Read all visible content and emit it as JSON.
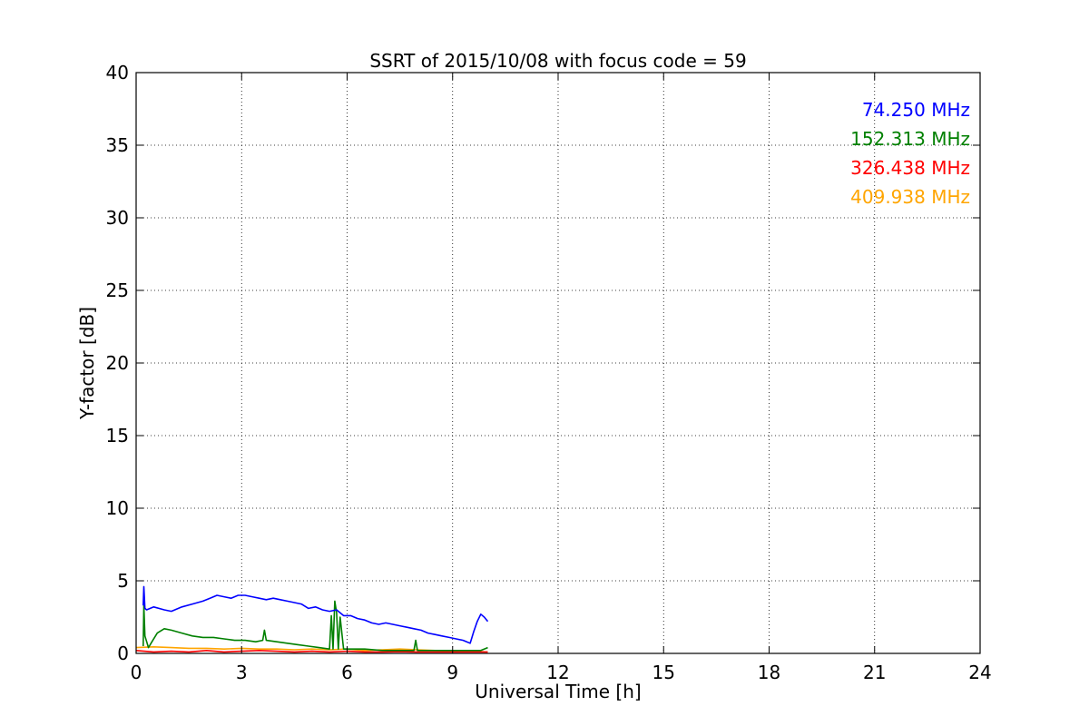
{
  "chart_data": {
    "type": "line",
    "title": "SSRT of 2015/10/08 with focus code = 59",
    "xlabel": "Universal Time [h]",
    "ylabel": "Y-factor [dB]",
    "xlim": [
      0,
      24
    ],
    "ylim": [
      0,
      40
    ],
    "xticks": [
      0,
      3,
      6,
      9,
      12,
      15,
      18,
      21,
      24
    ],
    "yticks": [
      0,
      5,
      10,
      15,
      20,
      25,
      30,
      35,
      40
    ],
    "grid": true,
    "legend_position": "top-right",
    "series": [
      {
        "name": "74.250 MHz",
        "color": "#0000ff",
        "x": [
          0.2,
          0.22,
          0.25,
          0.3,
          0.5,
          0.8,
          1.0,
          1.3,
          1.6,
          1.9,
          2.1,
          2.3,
          2.5,
          2.7,
          2.9,
          3.1,
          3.3,
          3.5,
          3.7,
          3.9,
          4.1,
          4.3,
          4.5,
          4.7,
          4.9,
          5.1,
          5.3,
          5.5,
          5.7,
          5.9,
          6.1,
          6.3,
          6.5,
          6.7,
          6.9,
          7.1,
          7.3,
          7.5,
          7.7,
          7.9,
          8.1,
          8.3,
          8.5,
          8.7,
          8.9,
          9.1,
          9.3,
          9.4,
          9.5,
          9.6,
          9.7,
          9.8,
          9.9,
          10.0
        ],
        "y": [
          3.3,
          4.6,
          3.1,
          3.0,
          3.2,
          3.0,
          2.9,
          3.2,
          3.4,
          3.6,
          3.8,
          4.0,
          3.9,
          3.8,
          4.0,
          4.0,
          3.9,
          3.8,
          3.7,
          3.8,
          3.7,
          3.6,
          3.5,
          3.4,
          3.1,
          3.2,
          3.0,
          2.9,
          3.0,
          2.6,
          2.6,
          2.4,
          2.3,
          2.1,
          2.0,
          2.1,
          2.0,
          1.9,
          1.8,
          1.7,
          1.6,
          1.4,
          1.3,
          1.2,
          1.1,
          1.0,
          0.9,
          0.8,
          0.7,
          1.5,
          2.2,
          2.7,
          2.5,
          2.2
        ]
      },
      {
        "name": "152.313 MHz",
        "color": "#008000",
        "x": [
          0.2,
          0.22,
          0.25,
          0.35,
          0.45,
          0.6,
          0.8,
          1.0,
          1.3,
          1.6,
          1.9,
          2.2,
          2.5,
          2.8,
          3.1,
          3.4,
          3.6,
          3.65,
          3.7,
          4.0,
          4.3,
          4.6,
          4.9,
          5.2,
          5.5,
          5.55,
          5.6,
          5.65,
          5.7,
          5.75,
          5.8,
          5.9,
          6.2,
          6.5,
          7.0,
          7.5,
          7.9,
          7.95,
          8.0,
          8.5,
          9.0,
          9.5,
          9.8,
          10.0
        ],
        "y": [
          0.5,
          3.3,
          1.2,
          0.4,
          0.8,
          1.4,
          1.7,
          1.6,
          1.4,
          1.2,
          1.1,
          1.1,
          1.0,
          0.9,
          0.9,
          0.8,
          0.9,
          1.6,
          0.9,
          0.8,
          0.7,
          0.6,
          0.5,
          0.4,
          0.3,
          2.6,
          0.3,
          3.6,
          2.8,
          0.3,
          2.5,
          0.3,
          0.3,
          0.3,
          0.2,
          0.2,
          0.2,
          0.9,
          0.2,
          0.2,
          0.2,
          0.2,
          0.2,
          0.4
        ]
      },
      {
        "name": "326.438 MHz",
        "color": "#ff0000",
        "x": [
          0.0,
          0.5,
          1.0,
          1.5,
          2.0,
          2.5,
          3.0,
          3.5,
          4.0,
          4.5,
          5.0,
          5.5,
          6.0,
          6.5,
          7.0,
          7.5,
          8.0,
          8.5,
          9.0,
          9.5,
          10.0
        ],
        "y": [
          0.2,
          0.1,
          0.15,
          0.1,
          0.2,
          0.1,
          0.15,
          0.2,
          0.15,
          0.1,
          0.15,
          0.1,
          0.15,
          0.1,
          0.1,
          0.12,
          0.1,
          0.1,
          0.1,
          0.1,
          0.1
        ]
      },
      {
        "name": "409.938 MHz",
        "color": "#ffa500",
        "x": [
          0.0,
          0.5,
          1.0,
          1.5,
          2.0,
          2.5,
          3.0,
          3.5,
          4.0,
          4.5,
          5.0,
          5.5,
          6.0,
          6.5,
          7.0,
          7.5,
          8.0,
          8.5,
          9.0,
          9.5,
          10.0
        ],
        "y": [
          0.4,
          0.45,
          0.4,
          0.35,
          0.35,
          0.3,
          0.35,
          0.3,
          0.3,
          0.25,
          0.3,
          0.25,
          0.3,
          0.2,
          0.25,
          0.3,
          0.25,
          0.2,
          0.15,
          0.15,
          0.1
        ]
      }
    ]
  }
}
